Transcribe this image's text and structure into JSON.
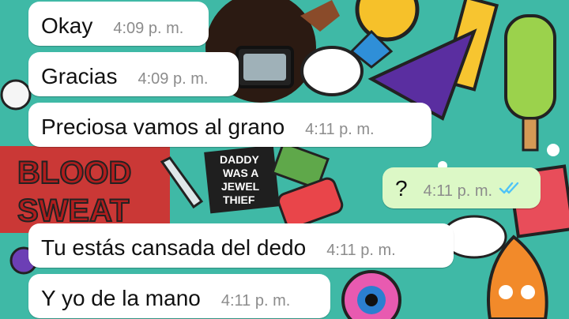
{
  "chat": {
    "messages": [
      {
        "text": "Okay",
        "time": "4:09 p. m.",
        "direction": "in"
      },
      {
        "text": "Gracias",
        "time": "4:09 p. m.",
        "direction": "in"
      },
      {
        "text": "Preciosa vamos al grano",
        "time": "4:11 p. m.",
        "direction": "in"
      },
      {
        "text": "?",
        "time": "4:11 p. m.",
        "direction": "out",
        "status": "read",
        "status_icon": "double-check-icon"
      },
      {
        "text": "Tu estás cansada del dedo",
        "time": "4:11 p. m.",
        "direction": "in"
      },
      {
        "text": "Y yo de la mano",
        "time": "4:11 p. m.",
        "direction": "in"
      }
    ]
  },
  "wallpaper": {
    "sticker_text": [
      "BLOOD",
      "SWEAT",
      "DADDY",
      "WAS A",
      "JEWEL",
      "THIEF"
    ]
  },
  "colors": {
    "incoming_bubble": "#ffffff",
    "outgoing_bubble": "#dcf8c6",
    "read_ticks": "#4fc3f7",
    "timestamp": "#8c8c8c"
  }
}
